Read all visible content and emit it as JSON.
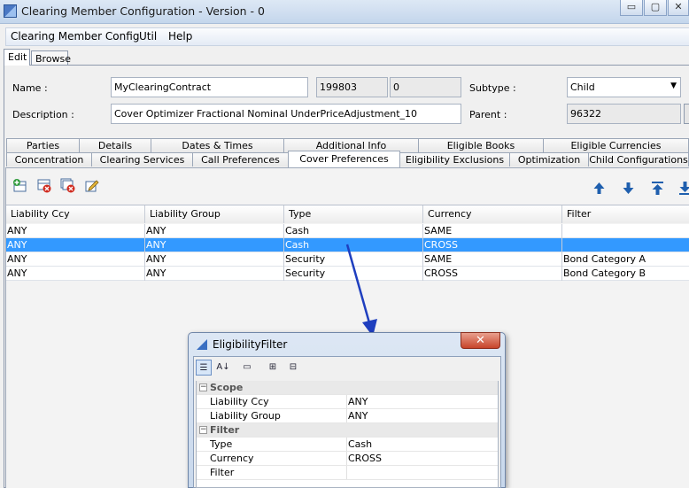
{
  "window": {
    "title": "Clearing Member Configuration - Version - 0",
    "controls": {
      "minimize": "▭",
      "maximize": "▢",
      "close": "✕"
    }
  },
  "menu": [
    "Clearing Member Config",
    "Util",
    "Help"
  ],
  "main_tabs": [
    "Edit",
    "Browse"
  ],
  "form": {
    "name_label": "Name :",
    "name_value": "MyClearingContract",
    "code1": "199803",
    "code2": "0",
    "subtype_label": "Subtype :",
    "subtype_value": "Child",
    "description_label": "Description :",
    "description_value": "Cover Optimizer Fractional Nominal UnderPriceAdjustment_10",
    "parent_label": "Parent :",
    "parent_value": "96322"
  },
  "tabs_row1": [
    "Parties",
    "Details",
    "Dates & Times",
    "Additional Info",
    "Eligible Books",
    "Eligible Currencies"
  ],
  "tabs_row2": [
    "Concentration",
    "Clearing Services",
    "Call Preferences",
    "Cover Preferences",
    "Eligibility Exclusions",
    "Optimization",
    "Child Configurations"
  ],
  "active_tab": "Cover Preferences",
  "toolbar_icons": [
    "add-icon",
    "delete-icon",
    "delete-all-icon",
    "edit-icon"
  ],
  "order_icons": [
    "move-up-icon",
    "move-down-icon",
    "move-top-icon",
    "move-bottom-icon"
  ],
  "table": {
    "columns": [
      "Liability Ccy",
      "Liability Group",
      "Type",
      "Currency",
      "Filter"
    ],
    "rows": [
      [
        "ANY",
        "ANY",
        "Cash",
        "SAME",
        ""
      ],
      [
        "ANY",
        "ANY",
        "Cash",
        "CROSS",
        ""
      ],
      [
        "ANY",
        "ANY",
        "Security",
        "SAME",
        "Bond Category A"
      ],
      [
        "ANY",
        "ANY",
        "Security",
        "CROSS",
        "Bond Category B"
      ]
    ],
    "selected_row": 1
  },
  "dialog": {
    "title": "EligibilityFilter",
    "close": "✕",
    "tools": [
      "categorized-icon",
      "alphabetical-icon",
      "property-pages-icon",
      "expand-icon",
      "collapse-icon"
    ],
    "categories": [
      {
        "name": "Scope",
        "items": [
          {
            "name": "Liability Ccy",
            "value": "ANY"
          },
          {
            "name": "Liability Group",
            "value": "ANY"
          }
        ]
      },
      {
        "name": "Filter",
        "items": [
          {
            "name": "Type",
            "value": "Cash"
          },
          {
            "name": "Currency",
            "value": "CROSS"
          },
          {
            "name": "Filter",
            "value": ""
          }
        ]
      }
    ]
  },
  "colors": {
    "selection": "#3399ff",
    "arrow": "#1f3fbf",
    "close_button": "#c7442a"
  }
}
